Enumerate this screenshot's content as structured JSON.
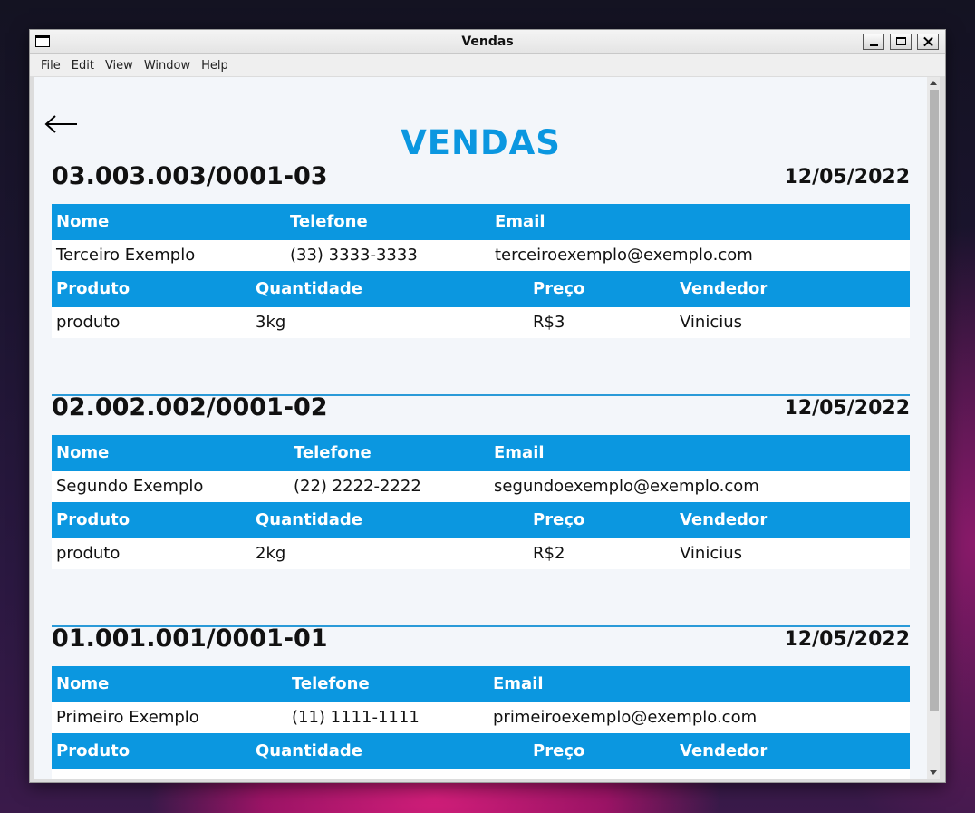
{
  "window": {
    "title": "Vendas"
  },
  "menu": [
    "File",
    "Edit",
    "View",
    "Window",
    "Help"
  ],
  "page": {
    "heading": "VENDAS"
  },
  "headers": {
    "customer": [
      "Nome",
      "Telefone",
      "Email"
    ],
    "product": [
      "Produto",
      "Quantidade",
      "Preço",
      "Vendedor"
    ]
  },
  "sales": [
    {
      "cnpj": "03.003.003/0001-03",
      "date": "12/05/2022",
      "nome": "Terceiro Exemplo",
      "telefone": "(33) 3333-3333",
      "email": "terceiroexemplo@exemplo.com",
      "produto": "produto",
      "quantidade": "3kg",
      "preco": "R$3",
      "vendedor": "Vinicius"
    },
    {
      "cnpj": "02.002.002/0001-02",
      "date": "12/05/2022",
      "nome": "Segundo Exemplo",
      "telefone": "(22) 2222-2222",
      "email": "segundoexemplo@exemplo.com",
      "produto": "produto",
      "quantidade": "2kg",
      "preco": "R$2",
      "vendedor": "Vinicius"
    },
    {
      "cnpj": "01.001.001/0001-01",
      "date": "12/05/2022",
      "nome": "Primeiro Exemplo",
      "telefone": "(11) 1111-1111",
      "email": "primeiroexemplo@exemplo.com"
    }
  ],
  "colors": {
    "accent": "#0b97e0",
    "background": "#f3f6fa",
    "divider": "#2a9ad8"
  }
}
